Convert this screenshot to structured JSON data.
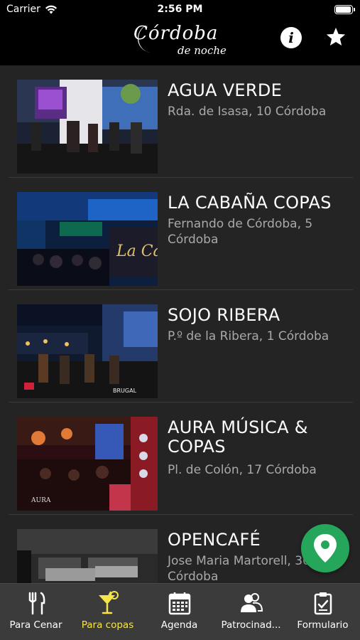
{
  "status": {
    "carrier": "Carrier",
    "time": "2:56 PM",
    "battery_level": 1.0
  },
  "header": {
    "logo_main": "Córdoba",
    "logo_sub": "de noche",
    "info_icon": "info-icon",
    "favorites_icon": "star-icon",
    "info_label": "i"
  },
  "venues": [
    {
      "name": "AGUA VERDE",
      "address": "Rda. de Isasa, 10 Córdoba"
    },
    {
      "name": "LA CABAÑA COPAS",
      "address": "Fernando de Córdoba, 5 Córdoba"
    },
    {
      "name": "SOJO RIBERA",
      "address": " P.º de la Ribera, 1 Córdoba"
    },
    {
      "name": "AURA MÚSICA & COPAS",
      "address": " Pl. de Colón, 17 Córdoba"
    },
    {
      "name": "OPENCAFÉ",
      "address": "Jose Maria Martorell, 36 Córdoba"
    }
  ],
  "fab": {
    "icon": "map-pin-icon"
  },
  "tabs": [
    {
      "label": "Para Cenar",
      "icon": "fork-knife-icon",
      "active": false
    },
    {
      "label": "Para copas",
      "icon": "cocktail-icon",
      "active": true
    },
    {
      "label": "Agenda",
      "icon": "calendar-icon",
      "active": false
    },
    {
      "label": "Patrocinad...",
      "icon": "people-icon",
      "active": false
    },
    {
      "label": "Formulario",
      "icon": "clipboard-icon",
      "active": false
    }
  ],
  "colors": {
    "accent": "#f5e54b",
    "fab": "#26a65b",
    "background": "#242424",
    "tabbar": "#3b3b3b"
  }
}
